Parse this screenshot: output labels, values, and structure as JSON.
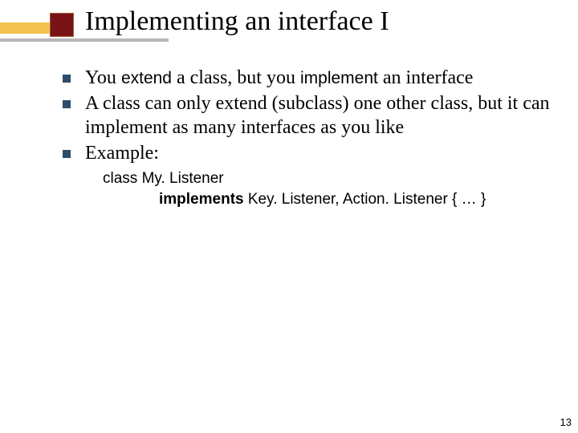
{
  "title": "Implementing an interface I",
  "bullets": [
    {
      "pre1": "You ",
      "kw1": "extend",
      "mid": " a class, but you ",
      "kw2": "implement",
      "post": " an interface"
    },
    {
      "text": "A class can only extend (subclass) one other class, but it can implement as many interfaces as you like"
    },
    {
      "text": "Example:"
    }
  ],
  "code": {
    "line1": "class My. Listener",
    "line2_kw": "implements",
    "line2_rest": " Key. Listener, Action. Listener { … }"
  },
  "page_number": "13"
}
